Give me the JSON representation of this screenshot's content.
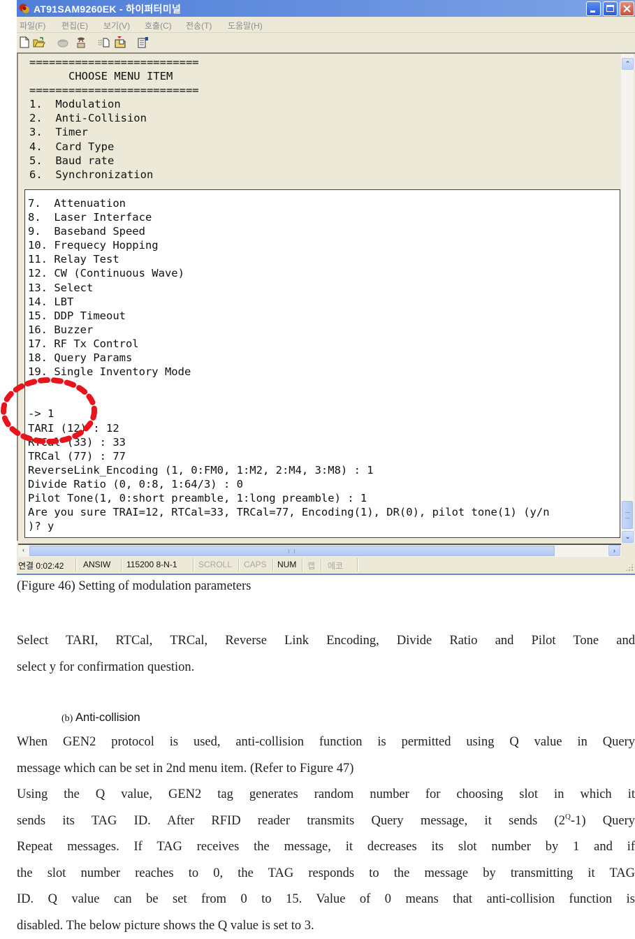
{
  "window": {
    "title": "AT91SAM9260EK - 하이퍼터미널",
    "app_icon": "hyperterminal-phone-icon",
    "controls": [
      "minimize",
      "maximize",
      "close"
    ]
  },
  "menubar": {
    "items": [
      {
        "label": "파일(F)"
      },
      {
        "label": "편집(E)"
      },
      {
        "label": "보기(V)"
      },
      {
        "label": "호출(C)"
      },
      {
        "label": "전송(T)"
      },
      {
        "label": "도움말(H)"
      }
    ]
  },
  "toolbar": {
    "icons": [
      "new-icon",
      "open-folder-icon",
      "connect-phone-icon",
      "disconnect-phone-icon",
      "send-icon",
      "receive-icon",
      "properties-icon"
    ]
  },
  "terminal": {
    "upper_lines": [
      "==========================",
      "      CHOOSE MENU ITEM",
      "==========================",
      "1.  Modulation",
      "2.  Anti-Collision",
      "3.  Timer",
      "4.  Card Type",
      "5.  Baud rate",
      "6.  Synchronization"
    ],
    "lower_lines": [
      "7.  Attenuation",
      "8.  Laser Interface",
      "9.  Baseband Speed",
      "10. Frequecy Hopping",
      "11. Relay Test",
      "12. CW (Continuous Wave)",
      "13. Select",
      "14. LBT",
      "15. DDP Timeout",
      "16. Buzzer",
      "17. RF Tx Control",
      "18. Query Params",
      "19. Single Inventory Mode",
      "",
      "",
      "-> 1",
      "TARI (12) : 12",
      "RTCal (33) : 33",
      "TRCal (77) : 77",
      "ReverseLink_Encoding (1, 0:FM0, 1:M2, 2:M4, 3:M8) : 1",
      "Divide Ratio (0, 0:8, 1:64/3) : 0",
      "Pilot Tone(1, 0:short preamble, 1:long preamble) : 1",
      "Are you sure TRAI=12, RTCal=33, TRCal=77, Encoding(1), DR(0), pilot tone(1) (y/n",
      ")? y"
    ]
  },
  "statusbar": {
    "connection": "연결 0:02:42",
    "emulation": "ANSIW",
    "port_settings": "115200 8-N-1",
    "scroll": "SCROLL",
    "caps": "CAPS",
    "num": "NUM",
    "capture": "캡",
    "echo": "에코"
  },
  "annotation": {
    "color": "#e8141c",
    "style": "dashed-circle",
    "highlights": "-> 1"
  },
  "document": {
    "caption": "(Figure 46) Setting of modulation parameters",
    "para1": [
      "Select TARI, RTCal, TRCal, Reverse Link Encoding, Divide Ratio and Pilot Tone and",
      "select y for confirmation question."
    ],
    "subhead_marker": "(b)",
    "subhead_label": "Anti-collision",
    "para2": [
      "When GEN2 protocol is used, anti-collision function is permitted using Q value in Query",
      "message which can be set in 2nd menu item. (Refer to Figure 47)",
      "Using the Q value, GEN2 tag generates random number for choosing slot in which it",
      "sends its TAG ID. After RFID reader transmits Query message, it sends (2",
      "Q",
      "-1) Query",
      "Repeat messages. If TAG receives the message, it decreases its slot number by 1 and if",
      "the slot number reaches to 0, the TAG responds to the message by transmitting it TAG",
      "ID. Q value can be set from 0 to 15. Value of 0 means that anti-collision function is",
      "disabled. The below picture shows the Q value is set to 3."
    ]
  }
}
